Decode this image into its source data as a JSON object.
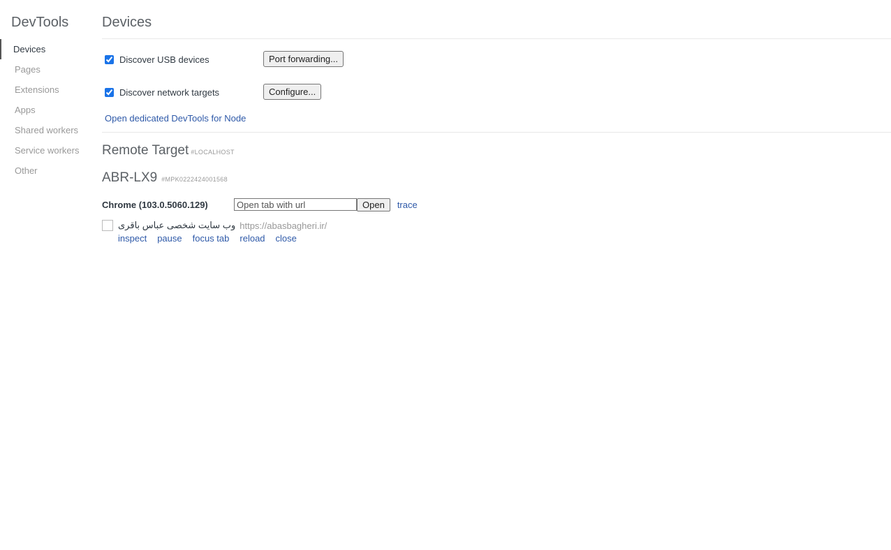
{
  "sidebar": {
    "title": "DevTools",
    "items": [
      {
        "label": "Devices",
        "selected": true
      },
      {
        "label": "Pages"
      },
      {
        "label": "Extensions"
      },
      {
        "label": "Apps"
      },
      {
        "label": "Shared workers"
      },
      {
        "label": "Service workers"
      },
      {
        "label": "Other"
      }
    ]
  },
  "main": {
    "title": "Devices",
    "discover_usb": {
      "label": "Discover USB devices",
      "checked": true,
      "button": "Port forwarding..."
    },
    "discover_network": {
      "label": "Discover network targets",
      "checked": true,
      "button": "Configure..."
    },
    "node_link": "Open dedicated DevTools for Node",
    "remote_target": {
      "title": "Remote Target",
      "subtitle": "#LOCALHOST"
    },
    "device": {
      "name": "ABR-LX9",
      "serial": "#MPK0222424001568",
      "browser": {
        "name": "Chrome (103.0.5060.129)",
        "url_placeholder": "Open tab with url",
        "open_label": "Open",
        "trace_label": "trace"
      },
      "targets": [
        {
          "name": "وب سایت شخصی عباس باقری",
          "url": "https://abasbagheri.ir/",
          "actions": [
            "inspect",
            "pause",
            "focus tab",
            "reload",
            "close"
          ]
        }
      ]
    }
  },
  "colors": {
    "link": "#2e59a8",
    "muted": "#999999",
    "text": "#303942",
    "accent": "#1a73e8"
  }
}
